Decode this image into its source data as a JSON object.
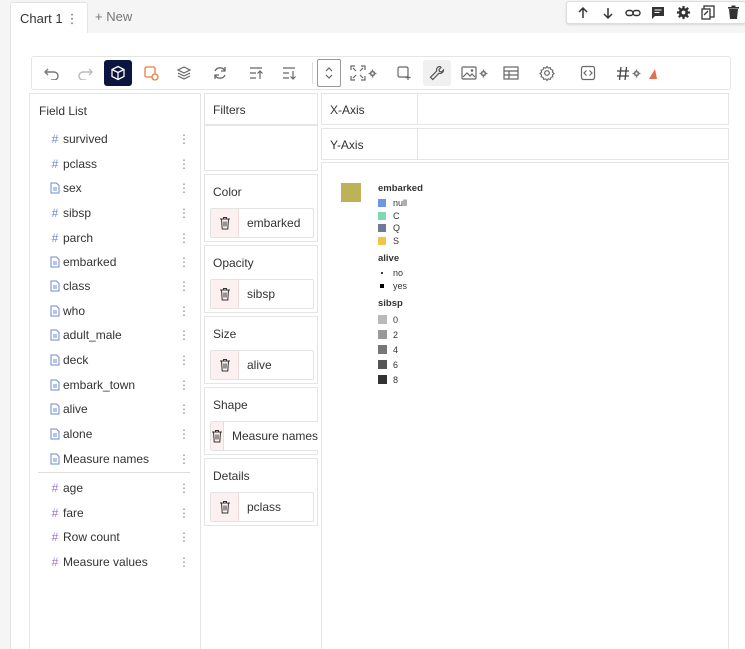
{
  "tabs": {
    "active_label": "Chart 1",
    "active_menu": "⋮",
    "new_label": "+ New"
  },
  "top_actions": [
    "arrow-up-icon",
    "arrow-down-icon",
    "link-icon",
    "comment-icon",
    "gear-icon",
    "export-icon",
    "trash-icon"
  ],
  "toolbar": [
    "undo-icon",
    "redo-icon",
    "cube-icon",
    "brush-icon",
    "layers-icon",
    "refresh-icon",
    "sort-ascending-icon",
    "sort-descending-icon",
    "chevron-updown-icon",
    "fit-screen-icon",
    "select-box-icon",
    "wrench-icon",
    "image-icon",
    "table-icon",
    "settings-icon",
    "code-icon",
    "hash-icon"
  ],
  "field_list": {
    "title": "Field List",
    "dimensions": [
      {
        "name": "survived",
        "type": "number"
      },
      {
        "name": "pclass",
        "type": "number"
      },
      {
        "name": "sex",
        "type": "text"
      },
      {
        "name": "sibsp",
        "type": "number"
      },
      {
        "name": "parch",
        "type": "number"
      },
      {
        "name": "embarked",
        "type": "text"
      },
      {
        "name": "class",
        "type": "text"
      },
      {
        "name": "who",
        "type": "text"
      },
      {
        "name": "adult_male",
        "type": "text"
      },
      {
        "name": "deck",
        "type": "text"
      },
      {
        "name": "embark_town",
        "type": "text"
      },
      {
        "name": "alive",
        "type": "text"
      },
      {
        "name": "alone",
        "type": "text"
      },
      {
        "name": "Measure names",
        "type": "text"
      }
    ],
    "measures": [
      {
        "name": "age"
      },
      {
        "name": "fare"
      },
      {
        "name": "Row count"
      },
      {
        "name": "Measure values"
      }
    ]
  },
  "encodings": {
    "filters_label": "Filters",
    "color_label": "Color",
    "color_field": "embarked",
    "opacity_label": "Opacity",
    "opacity_field": "sibsp",
    "size_label": "Size",
    "size_field": "alive",
    "shape_label": "Shape",
    "shape_field": "Measure names",
    "details_label": "Details",
    "details_field": "pclass"
  },
  "axes": {
    "x_label": "X-Axis",
    "y_label": "Y-Axis"
  },
  "legend": {
    "mark_color": "#bdb258",
    "embarked": {
      "title": "embarked",
      "items": [
        {
          "label": "null",
          "color": "#6f94e8"
        },
        {
          "label": "C",
          "color": "#7fd9b0"
        },
        {
          "label": "Q",
          "color": "#6c7b99"
        },
        {
          "label": "S",
          "color": "#f2c54a"
        }
      ]
    },
    "alive": {
      "title": "alive",
      "items": [
        {
          "label": "no"
        },
        {
          "label": "yes"
        }
      ]
    },
    "sibsp": {
      "title": "sibsp",
      "items": [
        {
          "label": "0",
          "color": "#b9b9b9"
        },
        {
          "label": "2",
          "color": "#999999"
        },
        {
          "label": "4",
          "color": "#777777"
        },
        {
          "label": "6",
          "color": "#555555"
        },
        {
          "label": "8",
          "color": "#333333"
        }
      ]
    }
  }
}
